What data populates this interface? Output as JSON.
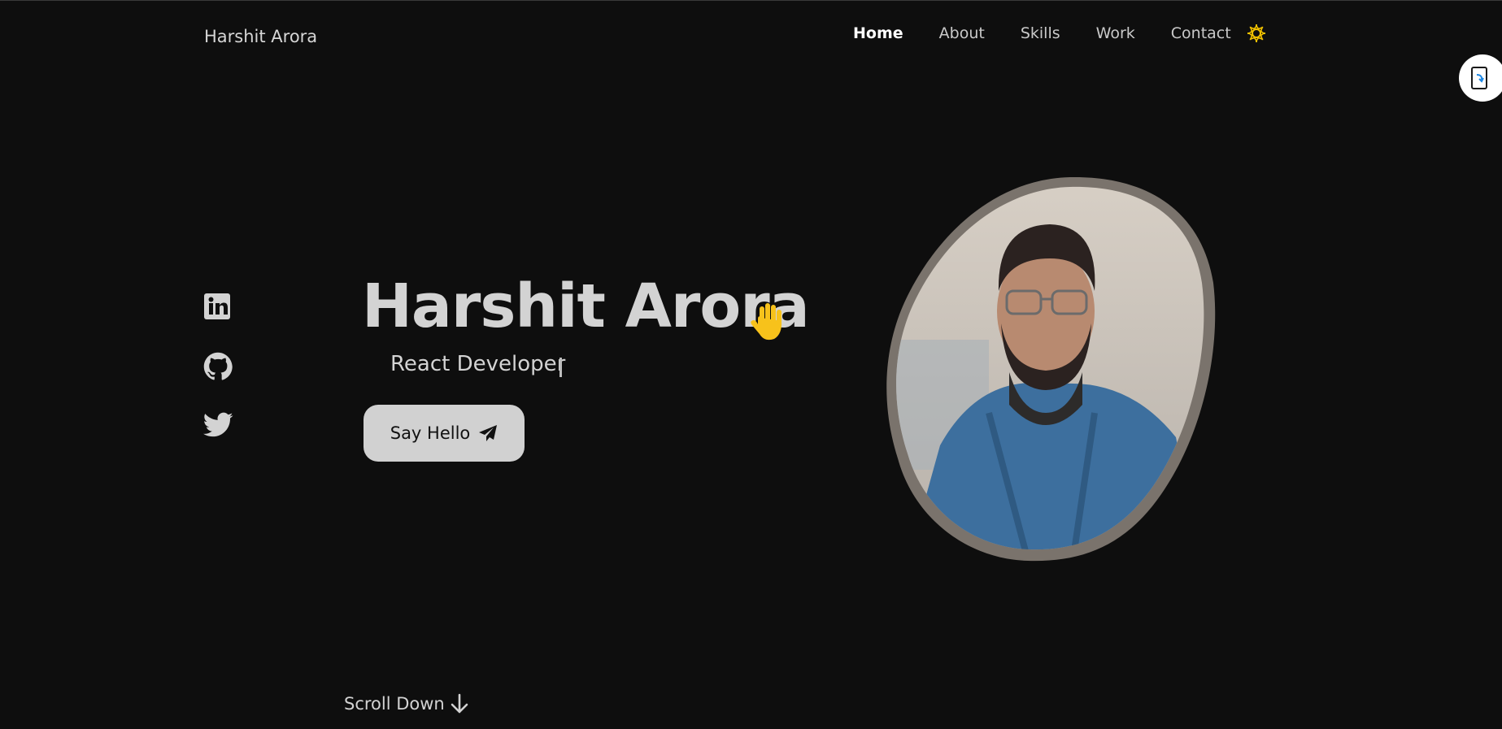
{
  "header": {
    "logo": "Harshit Arora",
    "nav": [
      {
        "label": "Home",
        "active": true
      },
      {
        "label": "About",
        "active": false
      },
      {
        "label": "Skills",
        "active": false
      },
      {
        "label": "Work",
        "active": false
      },
      {
        "label": "Contact",
        "active": false
      }
    ],
    "theme_icon": "sun-icon",
    "accent_color": "#f2c200"
  },
  "social": [
    {
      "icon": "linkedin-icon"
    },
    {
      "icon": "github-icon"
    },
    {
      "icon": "twitter-icon"
    }
  ],
  "hero": {
    "name": "Harshit Arora",
    "wave_icon": "waving-hand-icon",
    "role": "React Developer",
    "cta_label": "Say Hello",
    "cta_icon": "paper-plane-icon",
    "photo_alt": "portrait photo"
  },
  "scroll": {
    "label": "Scroll Down",
    "icon": "arrow-down-icon"
  },
  "colors": {
    "background": "#0e0e0e",
    "text": "#d3d3d3",
    "button_bg": "#d1d1d1",
    "blob_border": "#7a736c"
  }
}
